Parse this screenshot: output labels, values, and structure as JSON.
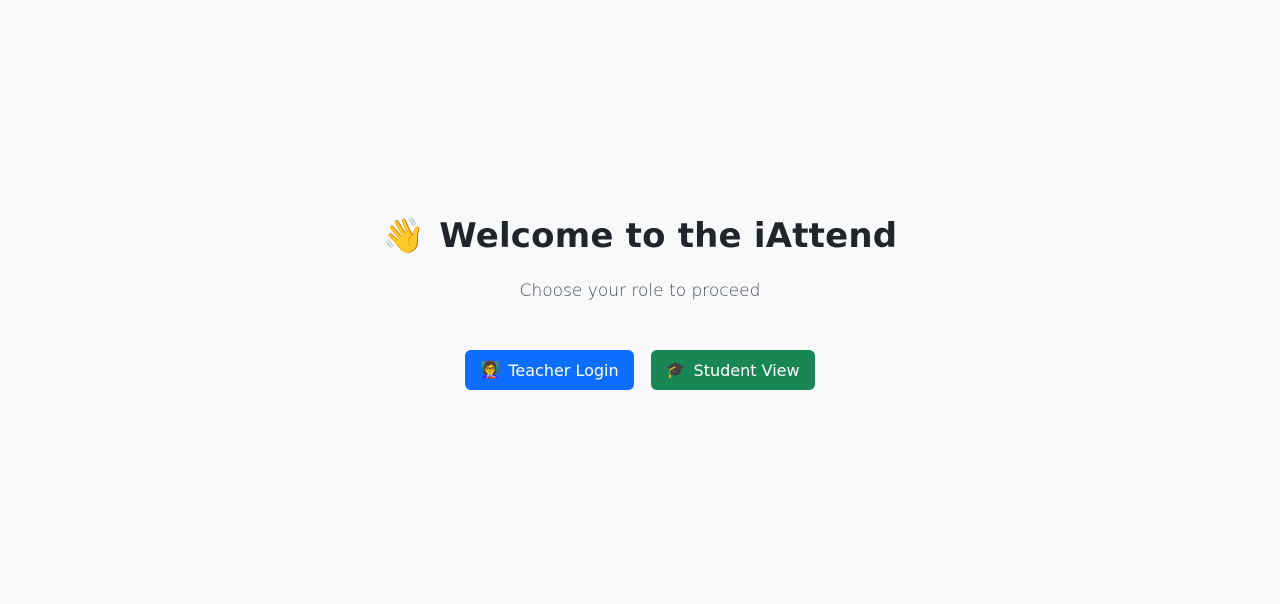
{
  "hero": {
    "wave_emoji": "👋",
    "title": "Welcome to the iAttend",
    "subtitle": "Choose your role to proceed"
  },
  "actions": {
    "teacher": {
      "icon": "👩‍🏫",
      "label": "Teacher Login"
    },
    "student": {
      "icon": "🎓",
      "label": "Student View"
    }
  },
  "colors": {
    "background": "#f8f9fa",
    "primary": "#0d6efd",
    "success": "#198754",
    "text": "#212529"
  }
}
